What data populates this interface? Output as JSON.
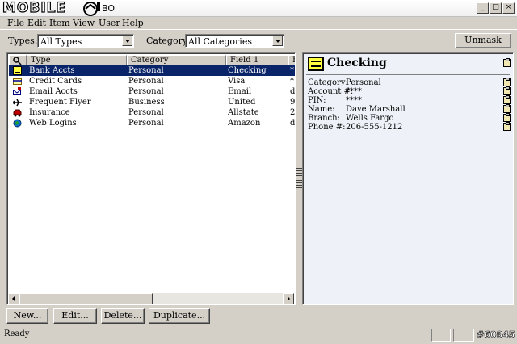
{
  "window": {
    "logo_text": "MOBILE",
    "title_suffix": "BO",
    "controls": {
      "minimize": "_",
      "maximize": "□",
      "close": "×"
    }
  },
  "menu": [
    {
      "label": "File",
      "accel": "F"
    },
    {
      "label": "Edit",
      "accel": "E"
    },
    {
      "label": "Item",
      "accel": "I"
    },
    {
      "label": "View",
      "accel": "V"
    },
    {
      "label": "User",
      "accel": "U"
    },
    {
      "label": "Help",
      "accel": "H"
    }
  ],
  "filters": {
    "types_label": "Types:",
    "types_value": "All Types",
    "category_label": "Category:",
    "category_value": "All Categories",
    "unmask_label": "Unmask"
  },
  "list": {
    "columns": [
      "",
      "Type",
      "Category",
      "Field 1",
      "F"
    ],
    "rows": [
      {
        "type": "Bank Accts",
        "category": "Personal",
        "field1": "Checking",
        "f": "*",
        "icon": "bank-icon",
        "selected": true
      },
      {
        "type": "Credit Cards",
        "category": "Personal",
        "field1": "Visa",
        "f": "*",
        "icon": "credit-card-icon",
        "selected": false
      },
      {
        "type": "Email Accts",
        "category": "Personal",
        "field1": "Email",
        "f": "d:",
        "icon": "email-icon",
        "selected": false
      },
      {
        "type": "Frequent Flyer",
        "category": "Business",
        "field1": "United",
        "f": "9:",
        "icon": "airplane-icon",
        "selected": false
      },
      {
        "type": "Insurance",
        "category": "Personal",
        "field1": "Allstate",
        "f": "2:",
        "icon": "car-icon",
        "selected": false
      },
      {
        "type": "Web Logins",
        "category": "Personal",
        "field1": "Amazon",
        "f": "d:",
        "icon": "globe-icon",
        "selected": false
      }
    ]
  },
  "detail": {
    "title": "Checking",
    "fields": [
      {
        "label": "Category:",
        "value": "Personal"
      },
      {
        "label": "Account #:",
        "value": "****"
      },
      {
        "label": "PIN:",
        "value": "****"
      },
      {
        "label": "Name:",
        "value": "Dave Marshall"
      },
      {
        "label": "Branch:",
        "value": "Wells Fargo"
      },
      {
        "label": "Phone #:",
        "value": "206-555-1212"
      }
    ]
  },
  "buttons": {
    "new": "New...",
    "edit": "Edit...",
    "delete": "Delete...",
    "duplicate": "Duplicate..."
  },
  "status": {
    "text": "Ready",
    "watermark": "#60845"
  }
}
